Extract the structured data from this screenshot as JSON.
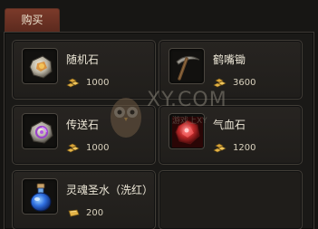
{
  "tab": {
    "label": "购买"
  },
  "items": [
    {
      "name": "随机石",
      "price": "1000",
      "icon": "random-stone-icon",
      "currency_icon": "gold-ingots-icon"
    },
    {
      "name": "鹤嘴锄",
      "price": "3600",
      "icon": "pickaxe-icon",
      "currency_icon": "gold-ingots-icon"
    },
    {
      "name": "传送石",
      "price": "1000",
      "icon": "teleport-stone-icon",
      "currency_icon": "gold-ingots-icon"
    },
    {
      "name": "气血石",
      "price": "1200",
      "icon": "hp-stone-icon",
      "currency_icon": "gold-ingots-icon"
    },
    {
      "name": "灵魂圣水（洗红）",
      "price": "200",
      "icon": "holy-water-potion-icon",
      "currency_icon": "gold-bar-icon"
    }
  ],
  "watermark": {
    "text": "XY.COM",
    "subtext": "游戏上XY"
  },
  "colors": {
    "tab_bg": "#6b3224",
    "panel_bg": "#1a1917",
    "item_border": "#403c36",
    "text": "#ece6d6",
    "gold": "#d9a53a"
  }
}
